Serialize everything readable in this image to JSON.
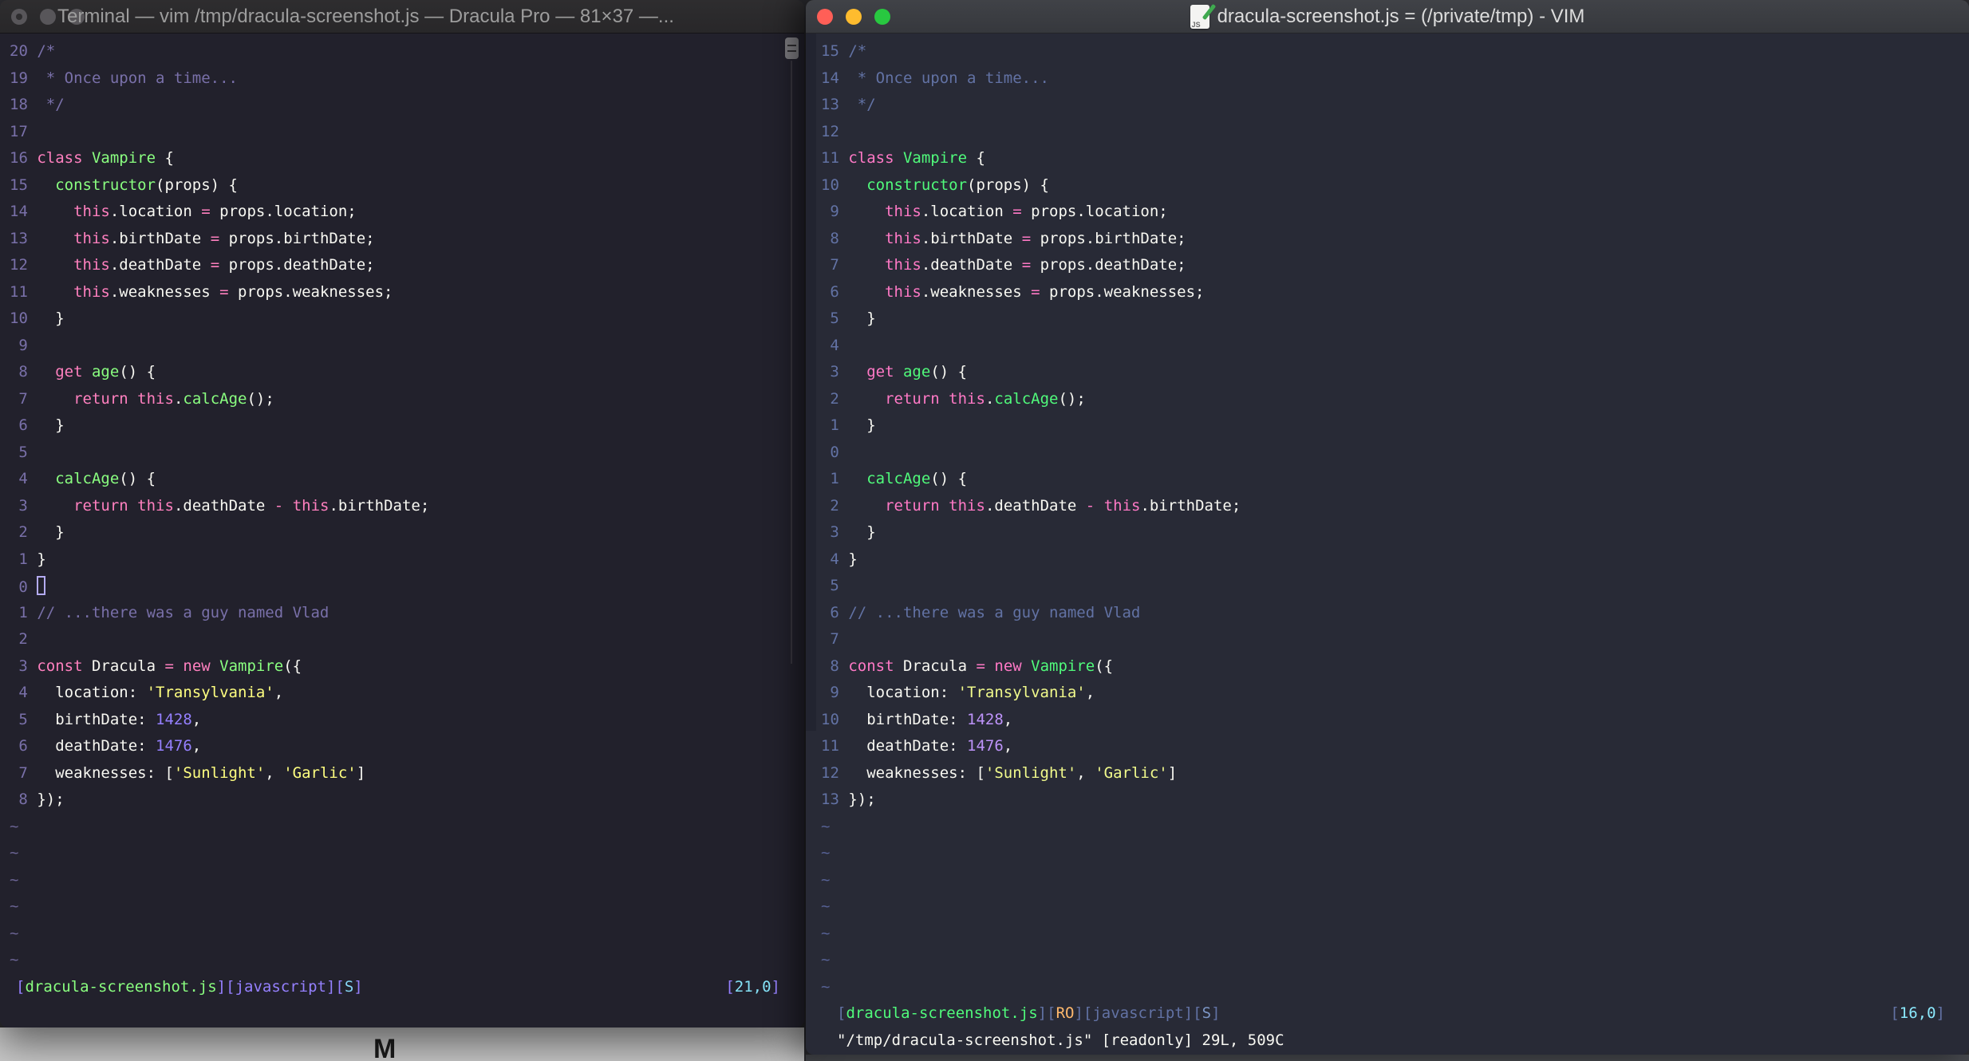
{
  "desktop": {
    "bottom_left_strip_color": "#c9c9c9",
    "bottom_right_strip_color": "#46484d",
    "background_glyph": "M"
  },
  "code_lines": [
    [
      [
        "/*",
        "c"
      ]
    ],
    [
      [
        " * Once upon a time...",
        "c"
      ]
    ],
    [
      [
        " */",
        "c"
      ]
    ],
    [],
    [
      [
        "class",
        "p"
      ],
      [
        " ",
        "f"
      ],
      [
        "Vampire",
        "g"
      ],
      [
        " {",
        "f"
      ]
    ],
    [
      [
        "  ",
        "f"
      ],
      [
        "constructor",
        "g"
      ],
      [
        "(props) {",
        "f"
      ]
    ],
    [
      [
        "    ",
        "f"
      ],
      [
        "this",
        "p"
      ],
      [
        ".location ",
        "f"
      ],
      [
        "=",
        "p"
      ],
      [
        " props.location;",
        "f"
      ]
    ],
    [
      [
        "    ",
        "f"
      ],
      [
        "this",
        "p"
      ],
      [
        ".birthDate ",
        "f"
      ],
      [
        "=",
        "p"
      ],
      [
        " props.birthDate;",
        "f"
      ]
    ],
    [
      [
        "    ",
        "f"
      ],
      [
        "this",
        "p"
      ],
      [
        ".deathDate ",
        "f"
      ],
      [
        "=",
        "p"
      ],
      [
        " props.deathDate;",
        "f"
      ]
    ],
    [
      [
        "    ",
        "f"
      ],
      [
        "this",
        "p"
      ],
      [
        ".weaknesses ",
        "f"
      ],
      [
        "=",
        "p"
      ],
      [
        " props.weaknesses;",
        "f"
      ]
    ],
    [
      [
        "  }",
        "f"
      ]
    ],
    [],
    [
      [
        "  ",
        "f"
      ],
      [
        "get",
        "p"
      ],
      [
        " ",
        "f"
      ],
      [
        "age",
        "g"
      ],
      [
        "() {",
        "f"
      ]
    ],
    [
      [
        "    ",
        "f"
      ],
      [
        "return",
        "p"
      ],
      [
        " ",
        "f"
      ],
      [
        "this",
        "p"
      ],
      [
        ".",
        "f"
      ],
      [
        "calcAge",
        "g"
      ],
      [
        "();",
        "f"
      ]
    ],
    [
      [
        "  }",
        "f"
      ]
    ],
    [],
    [
      [
        "  ",
        "f"
      ],
      [
        "calcAge",
        "g"
      ],
      [
        "() {",
        "f"
      ]
    ],
    [
      [
        "    ",
        "f"
      ],
      [
        "return",
        "p"
      ],
      [
        " ",
        "f"
      ],
      [
        "this",
        "p"
      ],
      [
        ".deathDate ",
        "f"
      ],
      [
        "-",
        "p"
      ],
      [
        " ",
        "f"
      ],
      [
        "this",
        "p"
      ],
      [
        ".birthDate;",
        "f"
      ]
    ],
    [
      [
        "  }",
        "f"
      ]
    ],
    [
      [
        "}",
        "f"
      ]
    ],
    [],
    [
      [
        "// ...there was a guy named Vlad",
        "c"
      ]
    ],
    [],
    [
      [
        "const",
        "p"
      ],
      [
        " Dracula ",
        "f"
      ],
      [
        "=",
        "p"
      ],
      [
        " ",
        "f"
      ],
      [
        "new",
        "p"
      ],
      [
        " ",
        "f"
      ],
      [
        "Vampire",
        "g"
      ],
      [
        "({",
        "f"
      ]
    ],
    [
      [
        "  location: ",
        "f"
      ],
      [
        "'Transylvania'",
        "y"
      ],
      [
        ",",
        "f"
      ]
    ],
    [
      [
        "  birthDate: ",
        "f"
      ],
      [
        "1428",
        "n"
      ],
      [
        ",",
        "f"
      ]
    ],
    [
      [
        "  deathDate: ",
        "f"
      ],
      [
        "1476",
        "n"
      ],
      [
        ",",
        "f"
      ]
    ],
    [
      [
        "  weaknesses: [",
        "f"
      ],
      [
        "'Sunlight'",
        "y"
      ],
      [
        ", ",
        "f"
      ],
      [
        "'Garlic'",
        "y"
      ],
      [
        "]",
        "f"
      ]
    ],
    [
      [
        "});",
        "f"
      ]
    ]
  ],
  "windows": {
    "left": {
      "app": "Terminal",
      "title": "Terminal — vim /tmp/dracula-screenshot.js — Dracula Pro — 81×37 —...",
      "focused": false,
      "cursor_line": 21,
      "cursor_col": 0,
      "cursor_visible": true,
      "tilde_rows": 6,
      "statusline": [
        [
          "[",
          "br"
        ],
        [
          "dracula-screenshot.js",
          "file"
        ],
        [
          "][",
          "br"
        ],
        [
          "javascript",
          "ft"
        ],
        [
          "][",
          "br"
        ],
        [
          "S",
          "flag"
        ],
        [
          "]",
          "br"
        ]
      ],
      "ruler": [
        [
          "[",
          "br"
        ],
        [
          "21,0",
          "ruler"
        ],
        [
          "]",
          "br"
        ]
      ],
      "command_line": "",
      "theme_name": "Dracula Pro",
      "theme": {
        "bg": "#22212C",
        "fg": "#F8F8F2",
        "c": "#7970A9",
        "linenr": "#7970A9",
        "p": "#FF80BF",
        "g": "#8AFF80",
        "y": "#FFFF80",
        "n": "#9580FF",
        "tilde": "#6A6393",
        "br": "#9580FF",
        "file": "#8AFF80",
        "ft": "#9580FF",
        "flag": "#85D5F4",
        "ruler": "#85E2F7",
        "ro": "#FFCA80"
      }
    },
    "right": {
      "app": "MacVim",
      "title": "dracula-screenshot.js = (/private/tmp) - VIM",
      "focused": true,
      "cursor_line": 16,
      "cursor_col": 0,
      "cursor_visible": false,
      "tilde_rows": 7,
      "statusline": [
        [
          "[",
          "br"
        ],
        [
          "dracula-screenshot.js",
          "file"
        ],
        [
          "][",
          "br"
        ],
        [
          "RO",
          "ro"
        ],
        [
          "][",
          "br"
        ],
        [
          "javascript",
          "ft"
        ],
        [
          "][",
          "br"
        ],
        [
          "S",
          "flag"
        ],
        [
          "]",
          "br"
        ]
      ],
      "ruler": [
        [
          "[",
          "br"
        ],
        [
          "16,0",
          "ruler"
        ],
        [
          "]",
          "br"
        ]
      ],
      "command_line": "\"/tmp/dracula-screenshot.js\" [readonly] 29L, 509C",
      "theme_name": "Dracula",
      "theme": {
        "bg": "#282A36",
        "fg": "#F8F8F2",
        "c": "#6272A4",
        "linenr": "#6272A4",
        "p": "#FF79C6",
        "g": "#50FA7B",
        "y": "#F1FA8C",
        "n": "#BD93F9",
        "tilde": "#566195",
        "br": "#6272A4",
        "file": "#50FA7B",
        "ft": "#6272A4",
        "flag": "#7C96C6",
        "ruler": "#8BE9FD",
        "ro": "#FFB86C"
      }
    }
  }
}
